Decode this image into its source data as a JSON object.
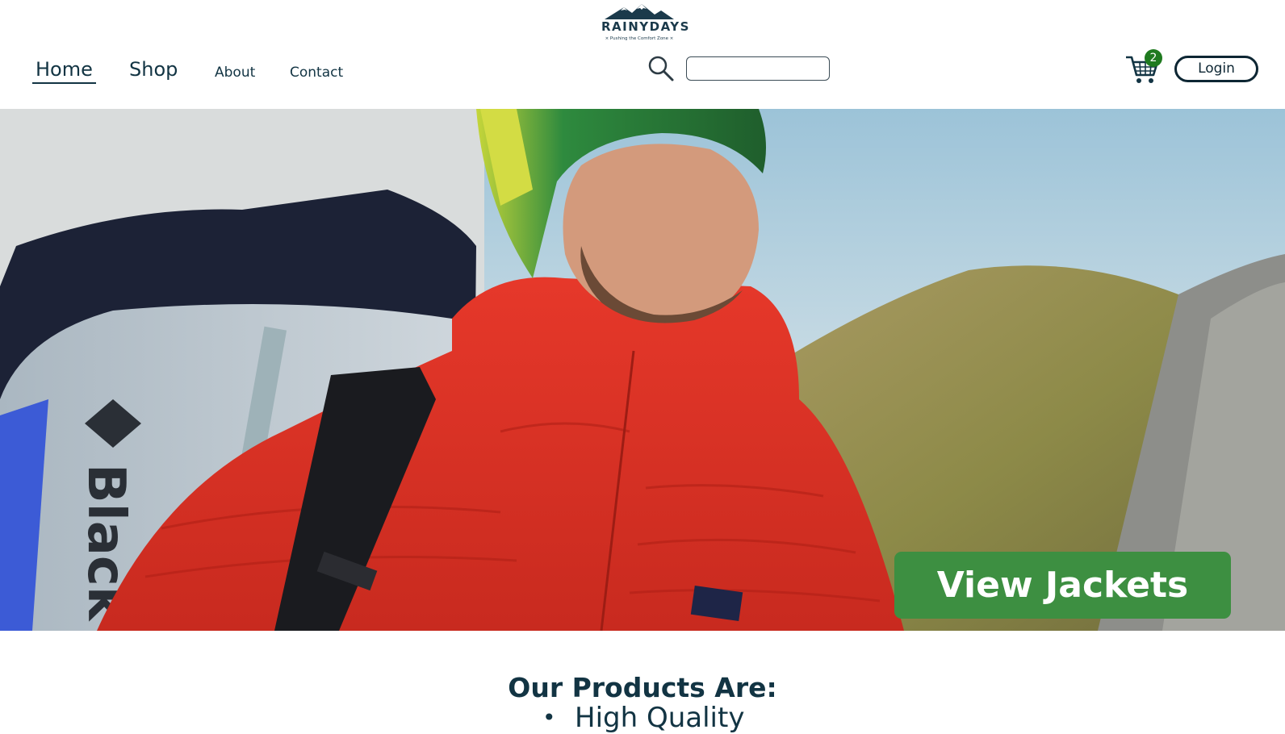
{
  "brand": {
    "name": "RAINYDAYS",
    "tagline": "× Pushing the Comfort Zone ×"
  },
  "nav": {
    "items": [
      {
        "label": "Home",
        "active": true
      },
      {
        "label": "Shop"
      },
      {
        "label": "About"
      },
      {
        "label": "Contact"
      }
    ]
  },
  "search": {
    "value": "",
    "placeholder": ""
  },
  "cart": {
    "count": "2"
  },
  "login": {
    "label": "Login"
  },
  "hero": {
    "cta_label": "View Jackets",
    "backpack_text": "Black"
  },
  "products": {
    "title": "Our Products Are:",
    "items": [
      "High Quality"
    ]
  },
  "colors": {
    "text": "#123443",
    "cta": "#3d8f41",
    "badge": "#1f7a1f"
  }
}
